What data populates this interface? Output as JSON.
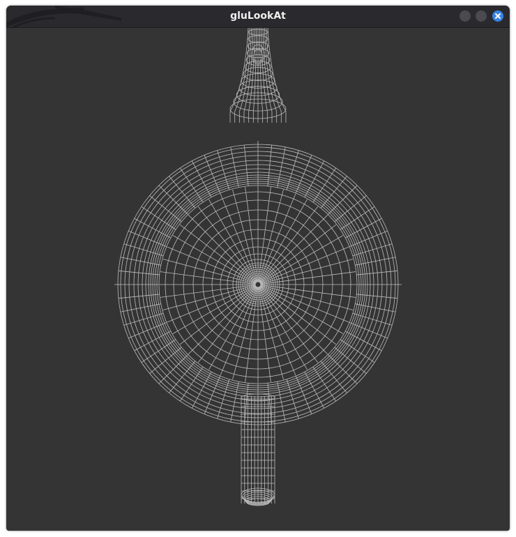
{
  "window": {
    "title": "gluLookAt",
    "buttons": [
      "minimize",
      "maximize",
      "close"
    ],
    "close_icon": "close-icon",
    "accent_color": "#3584e4",
    "background_color": "#343434",
    "wireframe_color": "#bdbdbd"
  }
}
